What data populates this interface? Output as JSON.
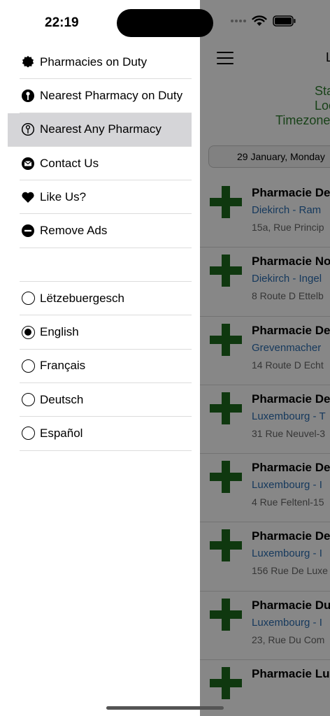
{
  "status_bar": {
    "time": "22:19"
  },
  "drawer": {
    "menu": [
      {
        "label": "Pharmacies on Duty",
        "icon": "badge-icon"
      },
      {
        "label": "Nearest Pharmacy on Duty",
        "icon": "location-pin-icon"
      },
      {
        "label": "Nearest Any Pharmacy",
        "icon": "location-pin-outline-icon",
        "selected": true
      },
      {
        "label": "Contact Us",
        "icon": "mail-icon"
      },
      {
        "label": "Like Us?",
        "icon": "heart-icon"
      },
      {
        "label": "Remove Ads",
        "icon": "minus-circle-icon"
      }
    ],
    "languages": [
      {
        "label": "Lëtzebuergesch",
        "selected": false
      },
      {
        "label": "English",
        "selected": true
      },
      {
        "label": "Français",
        "selected": false
      },
      {
        "label": "Deutsch",
        "selected": false
      },
      {
        "label": "Español",
        "selected": false
      }
    ]
  },
  "background": {
    "title": "L",
    "info_lines": [
      "Sta",
      "Loc",
      "Timezone"
    ],
    "date": "29 January, Monday",
    "pharmacies": [
      {
        "name": "Pharmacie De",
        "location": "Diekirch - Ram",
        "address": "15a, Rue Princip"
      },
      {
        "name": "Pharmacie No",
        "location": "Diekirch - Ingel",
        "address": "8 Route D Ettelb"
      },
      {
        "name": "Pharmacie De",
        "location": "Grevenmacher",
        "address": "14 Route D Echt"
      },
      {
        "name": "Pharmacie De",
        "location": "Luxembourg - T",
        "address": "31 Rue Neuvel-3"
      },
      {
        "name": "Pharmacie De",
        "location": "Luxembourg - I",
        "address": "4 Rue Feltenl-15"
      },
      {
        "name": "Pharmacie De",
        "location": "Luxembourg - I",
        "address": "156 Rue De Luxe"
      },
      {
        "name": "Pharmacie Du",
        "location": "Luxembourg - I",
        "address": "23, Rue Du Com"
      },
      {
        "name": "Pharmacie Lu",
        "location": "",
        "address": ""
      }
    ]
  }
}
